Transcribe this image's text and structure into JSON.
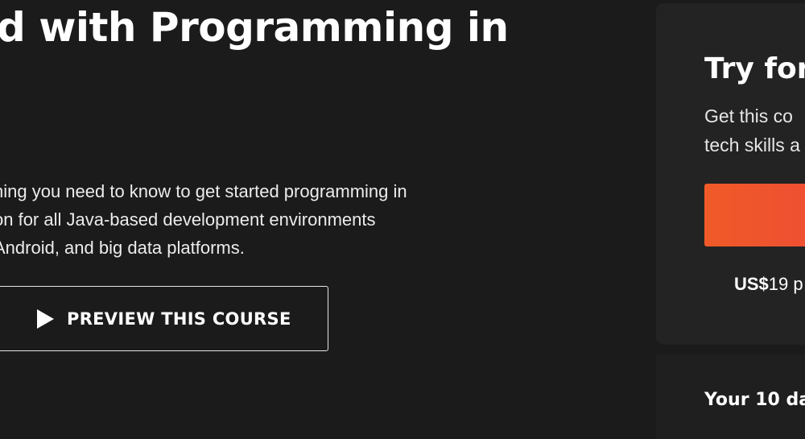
{
  "hero": {
    "title": "d with Programming in",
    "description_lines": [
      "hing you need to know to get started programming in",
      "on for all Java-based development environments",
      "Android, and big data platforms."
    ],
    "preview_button_label": "PREVIEW THIS COURSE"
  },
  "trial_card": {
    "title": "Try for",
    "text_lines": [
      "Get this co",
      "tech skills a"
    ],
    "price_currency": "US$",
    "price_value": "19 p"
  },
  "trial_days": "Your 10 da",
  "colors": {
    "background": "#1b1b1b",
    "card": "#232323",
    "cta_start": "#f05a28",
    "cta_end": "#ec4a37"
  },
  "icons": {
    "preview_button": "play-icon"
  }
}
